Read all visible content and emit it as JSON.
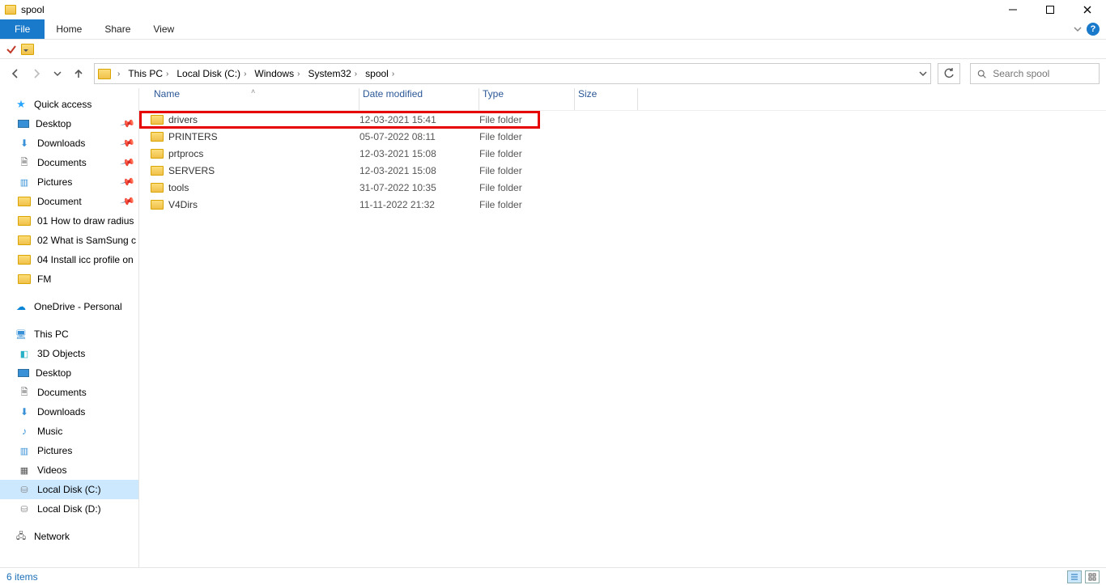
{
  "window": {
    "title": "spool"
  },
  "ribbon": {
    "file": "File",
    "tabs": [
      "Home",
      "Share",
      "View"
    ]
  },
  "breadcrumbs": [
    "This PC",
    "Local Disk (C:)",
    "Windows",
    "System32",
    "spool"
  ],
  "search": {
    "placeholder": "Search spool"
  },
  "sidebar": {
    "quick_access": "Quick access",
    "pinned": [
      {
        "icon": "desktop",
        "label": "Desktop"
      },
      {
        "icon": "down",
        "label": "Downloads"
      },
      {
        "icon": "doc",
        "label": "Documents"
      },
      {
        "icon": "pic",
        "label": "Pictures"
      },
      {
        "icon": "folder",
        "label": "Document"
      }
    ],
    "recent": [
      "01 How to draw radius",
      "02 What is SamSung c",
      "04 Install icc profile on",
      "FM"
    ],
    "onedrive": "OneDrive - Personal",
    "thispc": "This PC",
    "pc_children": [
      {
        "icon": "obj3d",
        "label": "3D Objects"
      },
      {
        "icon": "desktop",
        "label": "Desktop"
      },
      {
        "icon": "doc",
        "label": "Documents"
      },
      {
        "icon": "down",
        "label": "Downloads"
      },
      {
        "icon": "music",
        "label": "Music"
      },
      {
        "icon": "pic",
        "label": "Pictures"
      },
      {
        "icon": "vid",
        "label": "Videos"
      },
      {
        "icon": "drive",
        "label": "Local Disk (C:)"
      },
      {
        "icon": "drive",
        "label": "Local Disk (D:)"
      }
    ],
    "network": "Network"
  },
  "columns": {
    "name": "Name",
    "date": "Date modified",
    "type": "Type",
    "size": "Size"
  },
  "rows": [
    {
      "name": "drivers",
      "date": "12-03-2021 15:41",
      "type": "File folder"
    },
    {
      "name": "PRINTERS",
      "date": "05-07-2022 08:11",
      "type": "File folder"
    },
    {
      "name": "prtprocs",
      "date": "12-03-2021 15:08",
      "type": "File folder"
    },
    {
      "name": "SERVERS",
      "date": "12-03-2021 15:08",
      "type": "File folder"
    },
    {
      "name": "tools",
      "date": "31-07-2022 10:35",
      "type": "File folder"
    },
    {
      "name": "V4Dirs",
      "date": "11-11-2022 21:32",
      "type": "File folder"
    }
  ],
  "status": {
    "count": "6 items"
  }
}
